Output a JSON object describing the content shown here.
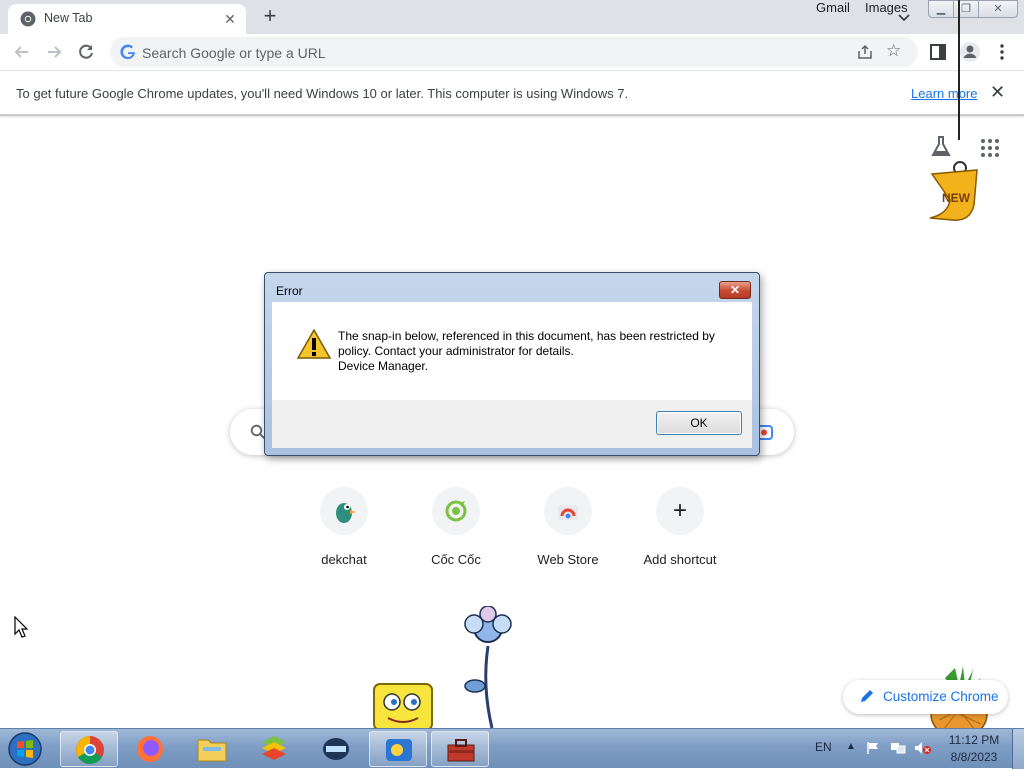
{
  "browser": {
    "tab": {
      "title": "New Tab",
      "close_label": "✕"
    },
    "new_tab_label": "+",
    "omnibox_placeholder": "Search Google or type a URL",
    "star_label": "☆"
  },
  "infobar": {
    "message": "To get future Google Chrome updates, you'll need Windows 10 or later. This computer is using Windows 7.",
    "learn_more": "Learn more",
    "close_label": "✕"
  },
  "ntp": {
    "gmail": "Gmail",
    "images": "Images",
    "badge": "NEW",
    "shortcuts": [
      {
        "label": "dekchat"
      },
      {
        "label": "Cốc Cốc"
      },
      {
        "label": "Web Store"
      },
      {
        "label": "Add shortcut",
        "symbol": "+"
      }
    ],
    "customize_label": "Customize Chrome"
  },
  "dialog": {
    "title": "Error",
    "close_label": "✕",
    "message_line1": "The snap-in below, referenced in this document, has been restricted by policy. Contact your administrator for details.",
    "message_line2": "Device Manager.",
    "ok_label": "OK"
  },
  "taskbar": {
    "language": "EN",
    "tray_arrow": "▲",
    "time": "11:12 PM",
    "date": "8/8/2023"
  },
  "colors": {
    "accent": "#1a73e8",
    "tabstrip": "#dee1e6",
    "taskbar": "#7f9ec6"
  }
}
